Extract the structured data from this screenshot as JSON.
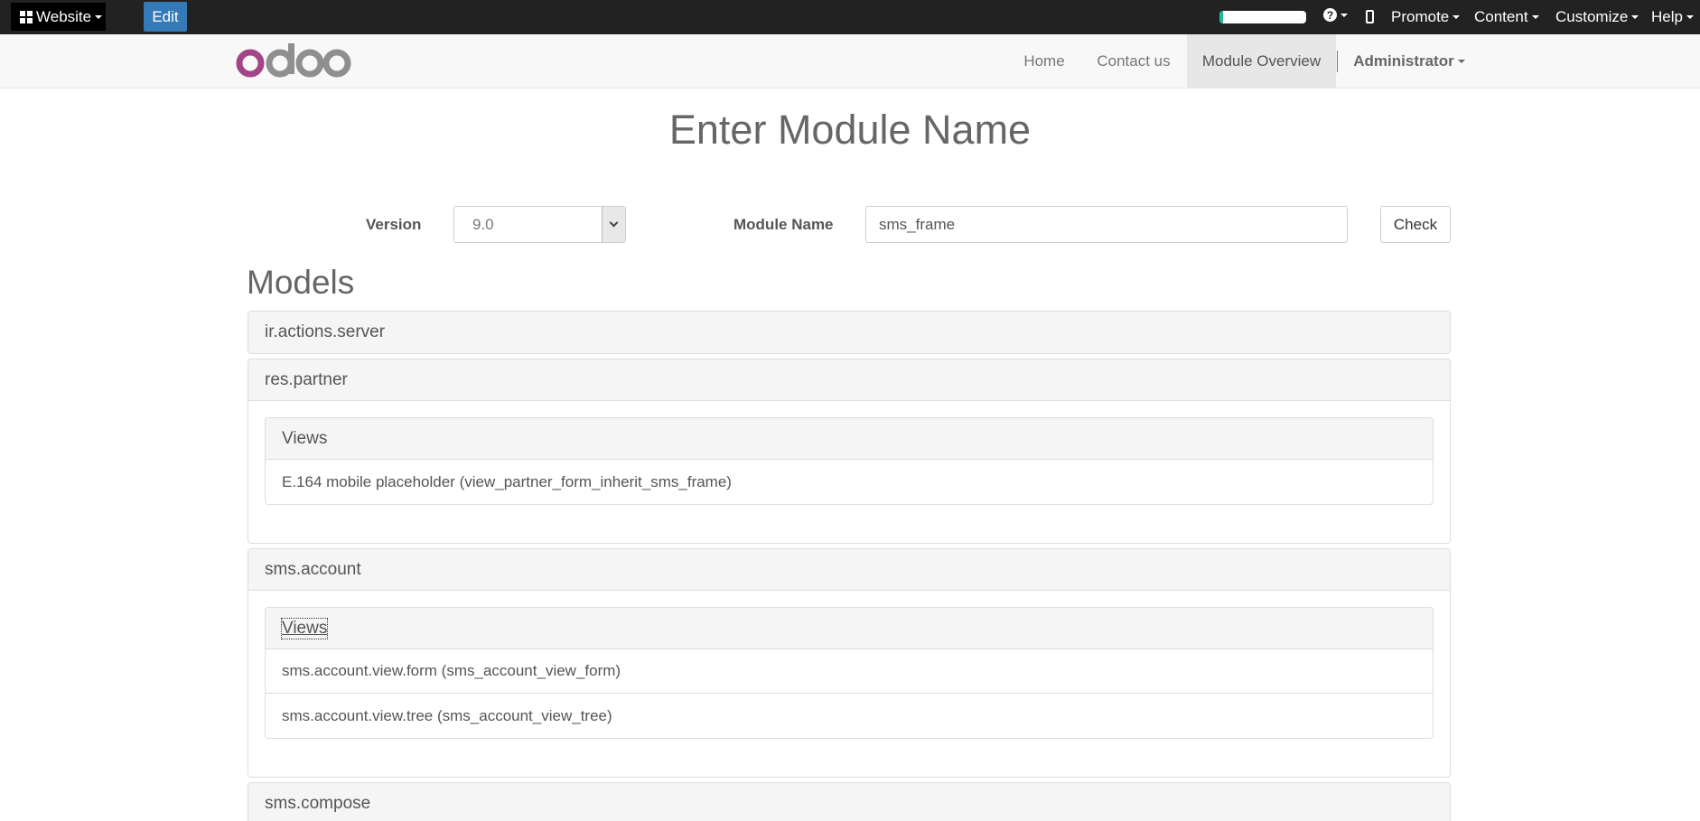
{
  "adminbar": {
    "website_label": "Website",
    "edit_label": "Edit",
    "progress_fraction": 0.04,
    "progress_color": "#21b799",
    "help_symbol": "?",
    "menus": [
      {
        "label": "Promote"
      },
      {
        "label": "Content"
      },
      {
        "label": "Customize"
      },
      {
        "label": "Help"
      }
    ]
  },
  "navbar": {
    "logo_text": "odoo",
    "links": [
      {
        "label": "Home"
      },
      {
        "label": "Contact us"
      },
      {
        "label": "Module Overview",
        "active": true
      }
    ],
    "user_label": "Administrator"
  },
  "main": {
    "title": "Enter Module Name",
    "form": {
      "version_label": "Version",
      "version_value": "9.0",
      "module_label": "Module Name",
      "module_value": "sms_frame",
      "check_label": "Check"
    },
    "models_heading": "Models",
    "models": [
      {
        "name": "ir.actions.server"
      },
      {
        "name": "res.partner",
        "views_label": "Views",
        "views": [
          "E.164 mobile placeholder (view_partner_form_inherit_sms_frame)"
        ]
      },
      {
        "name": "sms.account",
        "views_label": "Views",
        "views": [
          "sms.account.view.form (sms_account_view_form)",
          "sms.account.view.tree (sms_account_view_tree)"
        ]
      },
      {
        "name": "sms.compose"
      }
    ]
  },
  "colors": {
    "adminbar_bg": "#222222",
    "edit_button_bg": "#337ab7",
    "navbar_bg": "#f8f8f8",
    "logo_o_purple": "#a24689",
    "logo_gray": "#8f8f8f"
  }
}
